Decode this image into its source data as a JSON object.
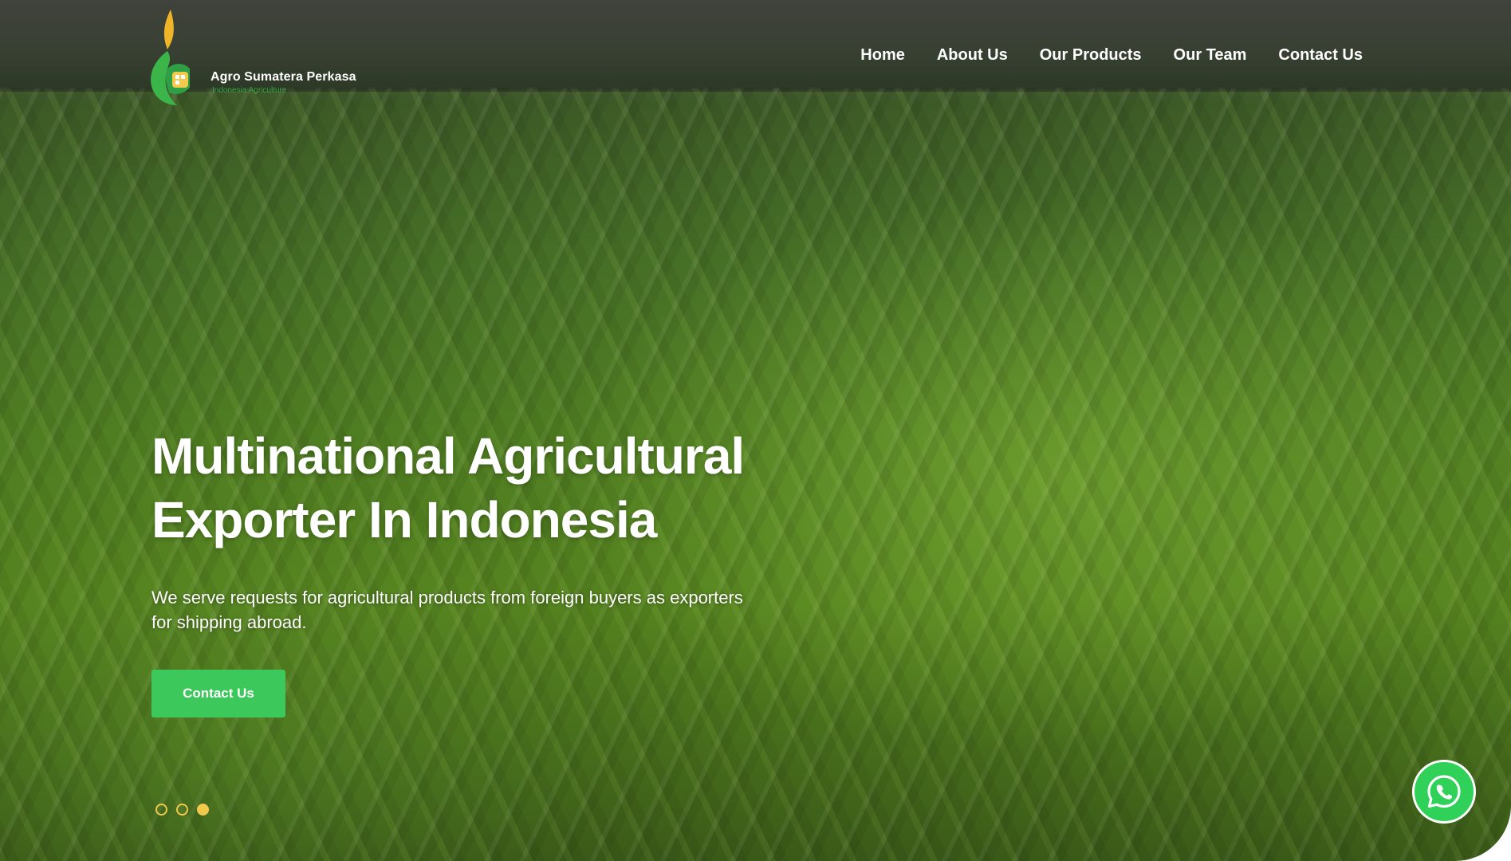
{
  "brand": {
    "name": "Agro Sumatera Perkasa",
    "tagline": "Indonesia Agriculture",
    "colors": {
      "accent": "#3cc85a",
      "dot": "#f2c94c",
      "whatsapp": "#2fd158"
    }
  },
  "nav": {
    "items": [
      {
        "label": "Home"
      },
      {
        "label": "About Us"
      },
      {
        "label": "Our Products"
      },
      {
        "label": "Our Team"
      },
      {
        "label": "Contact Us"
      }
    ]
  },
  "hero": {
    "title_line1": "Multinational Agricultural",
    "title_line2": "Exporter In Indonesia",
    "subtitle": "We serve requests for agricultural products from foreign buyers as exporters for shipping abroad.",
    "cta_label": "Contact Us",
    "slides": {
      "count": 3,
      "active_index": 2
    }
  },
  "floating": {
    "icon": "whatsapp-icon"
  }
}
